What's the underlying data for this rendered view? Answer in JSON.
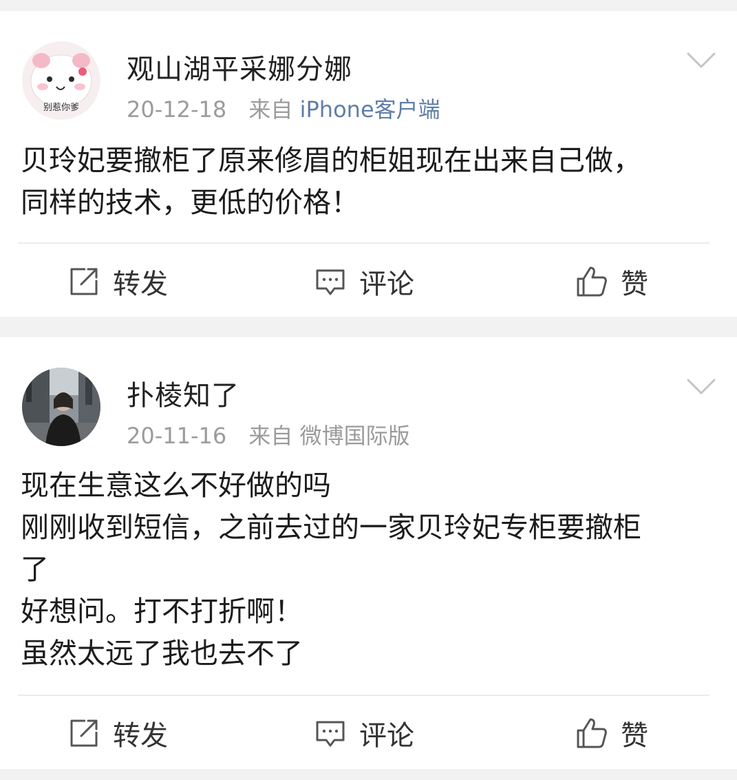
{
  "posts": [
    {
      "username": "观山湖平采娜分娜",
      "date": "20-12-18",
      "source_prefix": "来自",
      "source_client": "iPhone客户端",
      "avatar_caption": "别惹你爹",
      "content_lines": [
        "贝玲妃要撤柜了原来修眉的柜姐现在出来自己做，",
        "同样的技术，更低的价格！"
      ],
      "actions": {
        "repost": "转发",
        "comment": "评论",
        "like": "赞"
      }
    },
    {
      "username": "扑棱知了",
      "date": "20-11-16",
      "source_prefix": "来自",
      "source_client": "微博国际版",
      "content_lines": [
        "现在生意这么不好做的吗",
        "刚刚收到短信，之前去过的一家贝玲妃专柜要撤柜",
        "了",
        "好想问。打不打折啊！",
        "虽然太远了我也去不了"
      ],
      "actions": {
        "repost": "转发",
        "comment": "评论",
        "like": "赞"
      }
    }
  ],
  "icons": {
    "repost": "repost-icon",
    "comment": "comment-icon",
    "like": "thumbs-up-icon",
    "menu": "chevron-down-icon"
  },
  "colors": {
    "link": "#5f7ea8",
    "meta": "#9b9b9b",
    "text": "#1c1c1c",
    "background": "#f2f2f2"
  }
}
